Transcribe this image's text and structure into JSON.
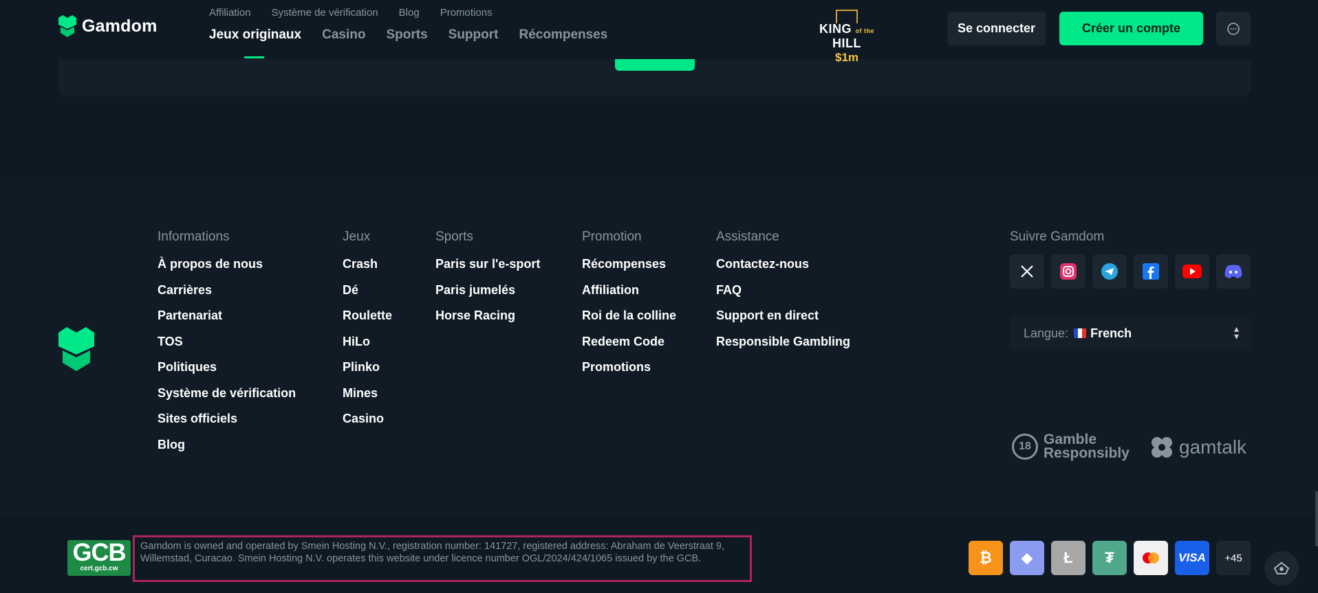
{
  "header": {
    "logo_text": "Gamdom",
    "subnav": [
      "Affiliation",
      "Système de vérification",
      "Blog",
      "Promotions"
    ],
    "mainnav": [
      "Jeux originaux",
      "Casino",
      "Sports",
      "Support",
      "Récompenses"
    ],
    "promo": {
      "line1": "KING",
      "of_the": "of the",
      "line1b": "HILL",
      "amount": "$1m"
    },
    "login_label": "Se connecter",
    "signup_label": "Créer un compte",
    "chat_icon": "chat-bubble-icon"
  },
  "footer": {
    "columns": [
      {
        "title": "Informations",
        "links": [
          "À propos de nous",
          "Carrières",
          "Partenariat",
          "TOS",
          "Politiques",
          "Système de vérification",
          "Sites officiels",
          "Blog"
        ]
      },
      {
        "title": "Jeux",
        "links": [
          "Crash",
          "Dé",
          "Roulette",
          "HiLo",
          "Plinko",
          "Mines",
          "Casino"
        ]
      },
      {
        "title": "Sports",
        "links": [
          "Paris sur l'e-sport",
          "Paris jumelés",
          "Horse Racing"
        ]
      },
      {
        "title": "Promotion",
        "links": [
          "Récompenses",
          "Affiliation",
          "Roi de la colline",
          "Redeem Code",
          "Promotions"
        ]
      },
      {
        "title": "Assistance",
        "links": [
          "Contactez-nous",
          "FAQ",
          "Support en direct",
          "Responsible Gambling"
        ]
      }
    ],
    "follow_title": "Suivre Gamdom",
    "socials": [
      "x-icon",
      "instagram-icon",
      "telegram-icon",
      "facebook-icon",
      "youtube-icon",
      "discord-icon"
    ],
    "language_label": "Langue:",
    "language_value": "French",
    "age_badge": "18",
    "responsible_line1": "Gamble",
    "responsible_line2": "Responsibly",
    "gamtalk": "gamtalk"
  },
  "bottom": {
    "gcb_main": "GCB",
    "gcb_sub": "cert.gcb.cw",
    "legal": "Gamdom is owned and operated by Smein Hosting N.V., registration number: 141727, registered address: Abraham de Veerstraat 9, Willemstad, Curacao. Smein Hosting N.V. operates this website under licence number OGL/2024/424/1065 issued by the GCB.",
    "payments": [
      {
        "name": "bitcoin-icon",
        "glyph": "₿",
        "color": "#f7931a"
      },
      {
        "name": "ethereum-icon",
        "glyph": "◆",
        "color": "#8a9bf0"
      },
      {
        "name": "litecoin-icon",
        "glyph": "Ł",
        "color": "#a7a7a7"
      },
      {
        "name": "tether-icon",
        "glyph": "₮",
        "color": "#4fa88c"
      },
      {
        "name": "mastercard-icon",
        "glyph": "",
        "color": "#f1f1f1"
      },
      {
        "name": "visa-icon",
        "glyph": "VISA",
        "color": "#1a5fe8"
      }
    ],
    "more_label": "+45"
  }
}
